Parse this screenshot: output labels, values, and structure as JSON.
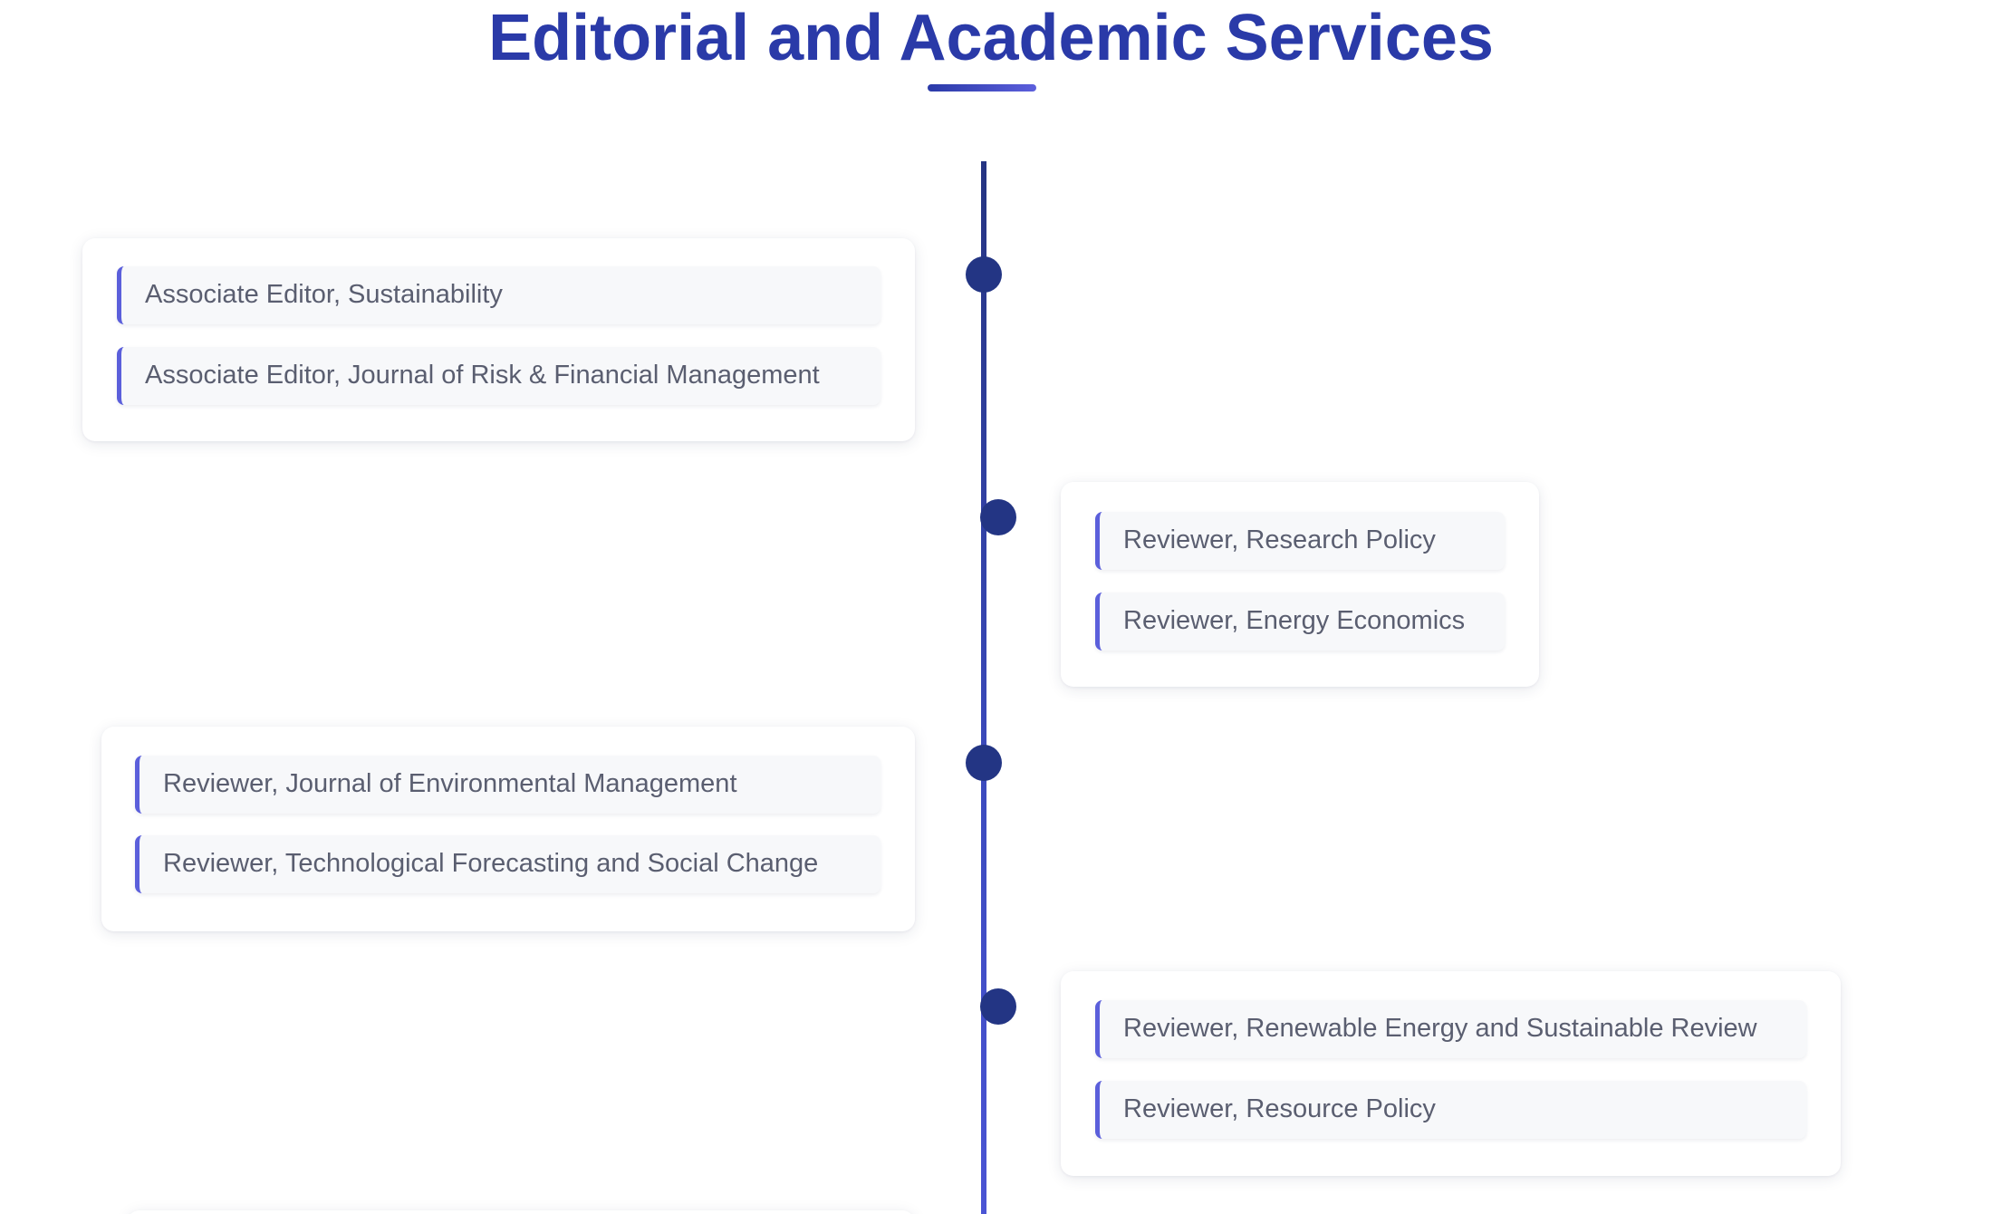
{
  "page": {
    "title": "Editorial and Academic Services"
  },
  "timeline": {
    "entries": [
      {
        "side": "left",
        "items": [
          "Associate Editor, Sustainability",
          "Associate Editor, Journal of Risk & Financial Management"
        ]
      },
      {
        "side": "right",
        "items": [
          "Reviewer, Research Policy",
          "Reviewer, Energy Economics"
        ]
      },
      {
        "side": "left",
        "items": [
          "Reviewer, Journal of Environmental Management",
          "Reviewer, Technological Forecasting and Social Change"
        ]
      },
      {
        "side": "right",
        "items": [
          "Reviewer, Renewable Energy and Sustainable Review",
          "Reviewer, Resource Policy"
        ]
      }
    ]
  },
  "colors": {
    "title": "#2a3aa8",
    "timeline_line": "#2b3a9c",
    "dot": "#233584",
    "item_accent": "#5b5fdb",
    "item_background": "#f7f8fa",
    "item_text": "#5a5e70"
  }
}
